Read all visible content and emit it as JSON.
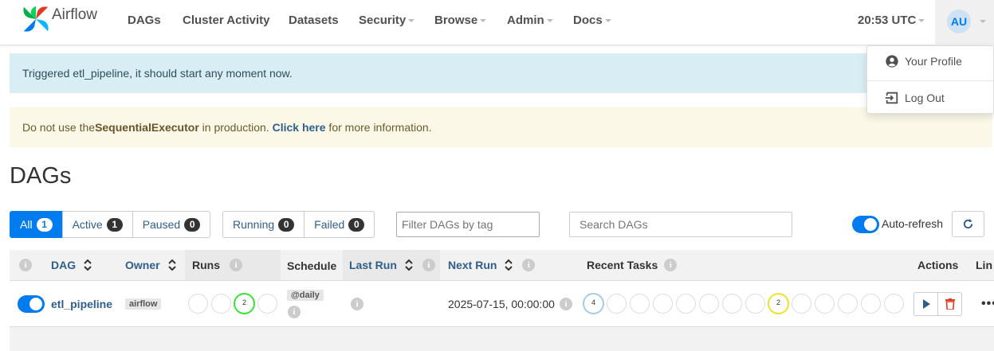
{
  "navbar": {
    "brand": "Airflow",
    "items": [
      "DAGs",
      "Cluster Activity",
      "Datasets",
      "Security",
      "Browse",
      "Admin",
      "Docs"
    ],
    "time": "20:53 UTC",
    "avatar": "AU"
  },
  "user_menu": {
    "profile": "Your Profile",
    "logout": "Log Out"
  },
  "alerts": {
    "info": "Triggered etl_pipeline, it should start any moment now.",
    "warn_prefix": "Do not use the ",
    "warn_executor": "SequentialExecutor",
    "warn_mid": " in production. ",
    "warn_link": "Click here",
    "warn_suffix": " for more information."
  },
  "page_title": "DAGs",
  "filters": {
    "status": [
      {
        "label": "All",
        "count": "1"
      },
      {
        "label": "Active",
        "count": "1"
      },
      {
        "label": "Paused",
        "count": "0"
      }
    ],
    "runs": [
      {
        "label": "Running",
        "count": "0"
      },
      {
        "label": "Failed",
        "count": "0"
      }
    ],
    "tag_filter_placeholder": "Filter DAGs by tag",
    "search_placeholder": "Search DAGs",
    "auto_refresh": "Auto-refresh"
  },
  "table": {
    "headers": {
      "info": "i",
      "dag": "DAG",
      "owner": "Owner",
      "runs": "Runs",
      "schedule": "Schedule",
      "last_run": "Last Run",
      "next_run": "Next Run",
      "recent_tasks": "Recent Tasks",
      "actions": "Actions",
      "links": "Lin"
    },
    "row": {
      "dag_id": "etl_pipeline",
      "owner": "airflow",
      "runs_running": "2",
      "schedule": "@daily",
      "next_run": "2025-07-15, 00:00:00",
      "tasks_queued": "4",
      "tasks_up_for_retry": "2",
      "more": "•••"
    }
  },
  "colors": {
    "accent": "#017cee",
    "link": "#2e5f8c",
    "running": "#32e632",
    "queued": "#a3cde3",
    "up_for_retry": "#f2e02b",
    "delete": "#e43921"
  }
}
